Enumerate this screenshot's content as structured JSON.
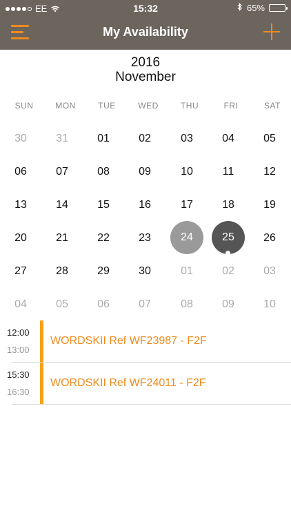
{
  "status": {
    "carrier": "EE",
    "time": "15:32",
    "battery": "65%",
    "battery_level": 0.65
  },
  "nav": {
    "title": "My Availability"
  },
  "calendar": {
    "year": "2016",
    "month": "November",
    "weekdays": [
      "SUN",
      "MON",
      "TUE",
      "WED",
      "THU",
      "FRI",
      "SAT"
    ],
    "weeks": [
      [
        "30",
        "31",
        "01",
        "02",
        "03",
        "04",
        "05"
      ],
      [
        "06",
        "07",
        "08",
        "09",
        "10",
        "11",
        "12"
      ],
      [
        "13",
        "14",
        "15",
        "16",
        "17",
        "18",
        "19"
      ],
      [
        "20",
        "21",
        "22",
        "23",
        "24",
        "25",
        "26"
      ],
      [
        "27",
        "28",
        "29",
        "30",
        "01",
        "02",
        "03"
      ],
      [
        "04",
        "05",
        "06",
        "07",
        "08",
        "09",
        "10"
      ]
    ],
    "highlighted_day": "24",
    "selected_day": "25"
  },
  "events": [
    {
      "start": "12:00",
      "end": "13:00",
      "title": "WORDSKII Ref WF23987 - F2F"
    },
    {
      "start": "15:30",
      "end": "16:30",
      "title": "WORDSKII Ref WF24011 - F2F"
    }
  ],
  "colors": {
    "accent": "#f08a1c",
    "event_bar": "#f5a01a",
    "header_bg": "#6c655e",
    "highlight": "#9a9a9a",
    "selected": "#555555"
  }
}
